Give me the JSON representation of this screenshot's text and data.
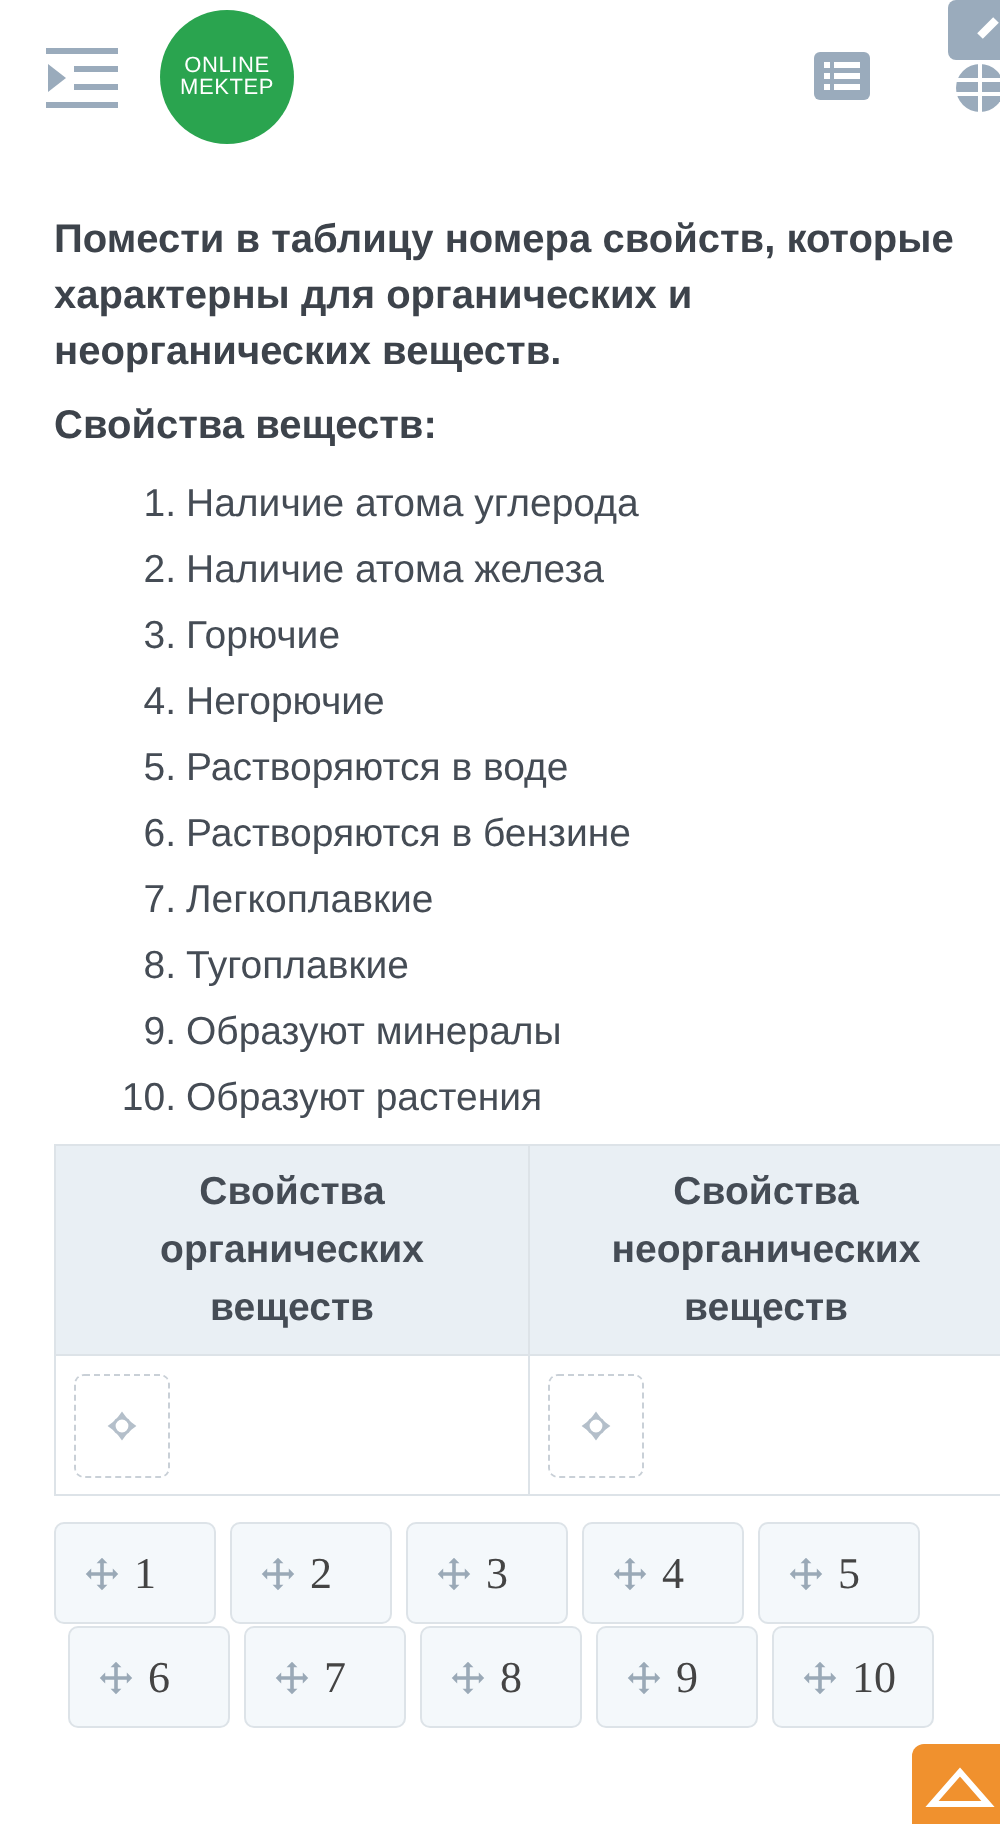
{
  "header": {
    "logo": [
      "ONLINE",
      "MEKTEP"
    ]
  },
  "question": "Помести в таблицу номера свойств, которые характерны для органических и неорганических веществ.",
  "list_title": "Свойства веществ:",
  "properties": [
    {
      "number": "1.",
      "text": "Наличие атома углерода"
    },
    {
      "number": "2.",
      "text": "Наличие атома железа"
    },
    {
      "number": "3.",
      "text": "Горючие"
    },
    {
      "number": "4.",
      "text": "Негорючие"
    },
    {
      "number": "5.",
      "text": "Растворяются в воде"
    },
    {
      "number": "6.",
      "text": "Растворяются в бензине"
    },
    {
      "number": "7.",
      "text": "Легкоплавкие"
    },
    {
      "number": "8.",
      "text": "Тугоплавкие"
    },
    {
      "number": "9.",
      "text": "Образуют минералы"
    },
    {
      "number": "10.",
      "text": "Образуют растения"
    }
  ],
  "table": {
    "columns": [
      "Свойства органических веществ",
      "Свойства неорганических веществ"
    ]
  },
  "tiles": [
    [
      "1",
      "2",
      "3",
      "4",
      "5"
    ],
    [
      "6",
      "7",
      "8",
      "9",
      "10"
    ]
  ]
}
